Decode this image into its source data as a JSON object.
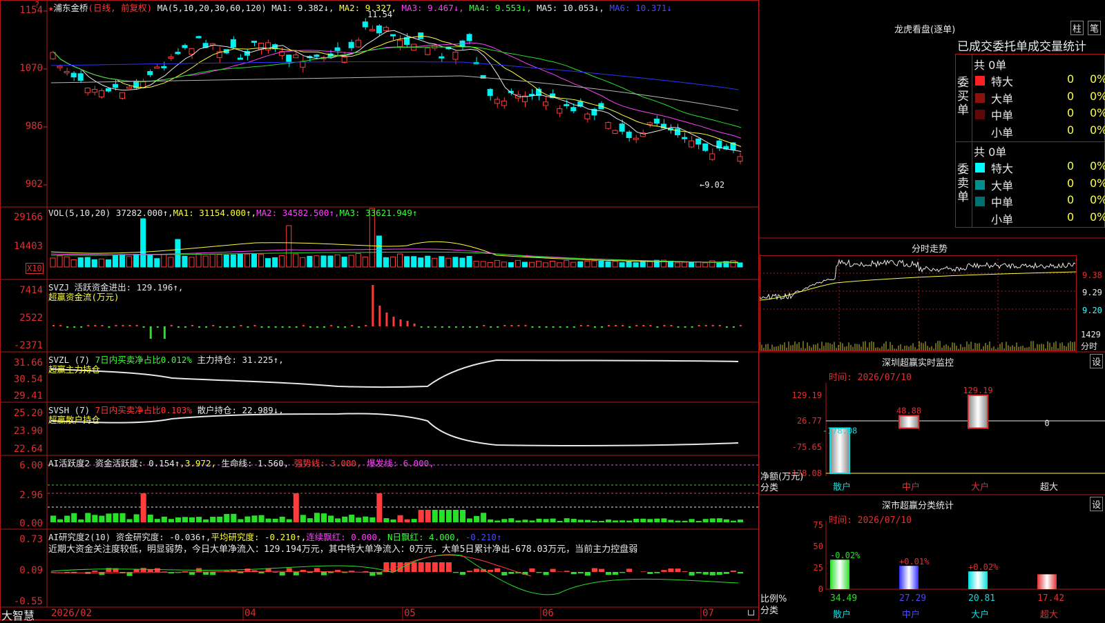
{
  "colors": {
    "up": "#ff3c3c",
    "down": "#00f0f0",
    "frame": "#b01818",
    "axis_text": "#e03030",
    "ma1": "#e8e8e8",
    "ma2": "#ffff3c",
    "ma3": "#ff40ff",
    "ma4": "#28e028",
    "ma5": "#b8b8b8",
    "ma6": "#3030ff"
  },
  "header": {
    "stock_name": "浦东金桥",
    "period_label": "(日线, 前复权)",
    "ma_params": "MA(5,10,20,30,60,120)",
    "ma1": "MA1: 9.382↓,",
    "ma2": "MA2: 9.327,",
    "ma3": "MA3: 9.467↓,",
    "ma4": "MA4: 9.553↓,",
    "ma5": "MA5: 10.053↓,",
    "ma6": "MA6: 10.371↓"
  },
  "price_axis": {
    "ticks": [
      "1154",
      "1070",
      "986",
      "902"
    ],
    "high_label": "11.54",
    "low_label": "←9.02"
  },
  "vol": {
    "params": "VOL(5,10,20)",
    "value": "37282.000↑,",
    "ma1": "MA1: 31154.000↑,",
    "ma2": "MA2: 34582.500↑,",
    "ma3": "MA3: 33621.949↑",
    "ticks": [
      "29166",
      "14403"
    ],
    "unit": "X10"
  },
  "svzj": {
    "title": "SVZJ  活跃资金进出: 129.196↑,",
    "subtitle": "超赢资金流(万元)",
    "ticks": [
      "7414",
      "2522",
      "-2371"
    ]
  },
  "svzl": {
    "title": "SVZL (7)",
    "desc": "7日内买卖净占比0.012%",
    "value": "主力持仓: 31.225↑,",
    "subtitle": "超赢主力持仓",
    "ticks": [
      "31.66",
      "30.54",
      "29.41"
    ]
  },
  "svsh": {
    "title": "SVSH (7)",
    "desc": "7日内买卖净占比0.103%",
    "value": "散户持仓: 22.989↓,",
    "subtitle": "超赢散户持仓",
    "ticks": [
      "25.20",
      "23.90",
      "22.64"
    ]
  },
  "ai_active": {
    "title": "AI活跃度2 资金活跃度: 0.154↑,",
    "v2": "3.972,",
    "v3": "生命线: 1.560,",
    "v4": "强势线: 3.000,",
    "v5": "爆发线: 6.000,",
    "ticks": [
      "6.00",
      "2.96",
      "0.00"
    ]
  },
  "ai_research": {
    "title": "AI研究度2(10) 资金研究度: -0.036↑,",
    "v2": "平均研究度: -0.210↑,",
    "v3": "连续飘红: 0.000,",
    "v4": "N日飘红: 4.000,",
    "v5": "-0.210↑",
    "note": "近期大资金关注度较低，明显弱势，今日大单净流入：129.194万元，其中特大单净流入：0万元，大单5日累计净出-678.03万元，当前主力控盘弱",
    "ticks": [
      "0.73",
      "0.09",
      "-0.55"
    ]
  },
  "date_axis": [
    "2026/02",
    "04",
    "05",
    "06",
    "07"
  ],
  "bottom_left_label": "大智慧",
  "dragon": {
    "title": "龙虎看盘(逐单)",
    "btn_bar": "柱",
    "btn_pen": "笔",
    "subtitle": "已成交委托单成交量统计",
    "buy_label": "委买单",
    "sell_label": "委卖单",
    "buy_total": "共 0单",
    "sell_total": "共 0单",
    "buy_rows": [
      {
        "name": "特大",
        "n": "0",
        "p": "0%",
        "c": "#ff2020"
      },
      {
        "name": "大单",
        "n": "0",
        "p": "0%",
        "c": "#901010"
      },
      {
        "name": "中单",
        "n": "0",
        "p": "0%",
        "c": "#600808"
      },
      {
        "name": "小单",
        "n": "0",
        "p": "0%",
        "c": ""
      }
    ],
    "sell_rows": [
      {
        "name": "特大",
        "n": "0",
        "p": "0%",
        "c": "#00ffff"
      },
      {
        "name": "大单",
        "n": "0",
        "p": "0%",
        "c": "#009090"
      },
      {
        "name": "中单",
        "n": "0",
        "p": "0%",
        "c": "#007070"
      },
      {
        "name": "小单",
        "n": "0",
        "p": "0%",
        "c": ""
      }
    ]
  },
  "intraday": {
    "title": "分时走势",
    "ticks": [
      "9.38",
      "9.29",
      "9.20"
    ],
    "vol_tick": "1429",
    "vol_unit": "分时"
  },
  "monitor": {
    "title": "深圳超赢实时监控",
    "settings": "设",
    "time": "时间: 2026/07/10",
    "ticks": [
      "129.19",
      "26.77",
      "-75.65",
      "-178.08"
    ],
    "ylabel": "净额(万元)",
    "xlabel": "分类",
    "categories": [
      "散户",
      "中户",
      "大户",
      "超大"
    ],
    "values": [
      -178.08,
      48.88,
      129.19,
      0
    ],
    "value_labels": [
      "-178.08",
      "48.88",
      "129.19",
      "0"
    ]
  },
  "classify": {
    "title": "深市超赢分类统计",
    "settings": "设",
    "time": "时间: 2026/07/10",
    "ticks": [
      "75",
      "50",
      "25",
      "0"
    ],
    "ylabel": "比例%",
    "xlabel": "分类",
    "categories": [
      "散户",
      "中户",
      "大户",
      "超大"
    ],
    "values": [
      34.49,
      27.29,
      20.81,
      17.42
    ],
    "value_labels": [
      "34.49",
      "27.29",
      "20.81",
      "17.42"
    ],
    "changes": [
      "-0.02%",
      "+0.01%",
      "+0.02%",
      ""
    ]
  }
}
